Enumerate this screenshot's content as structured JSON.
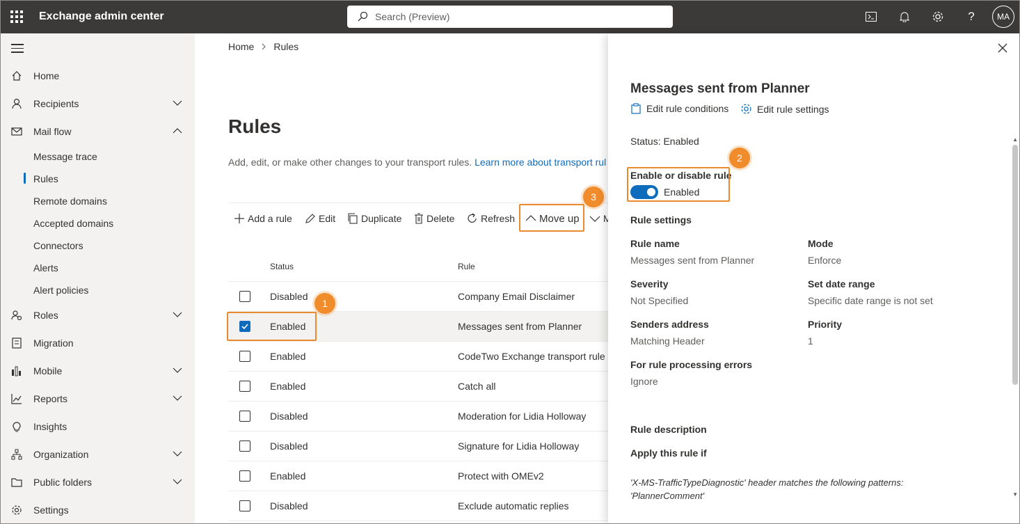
{
  "topbar": {
    "app_title": "Exchange admin center",
    "search_placeholder": "Search (Preview)",
    "avatar_initials": "MA"
  },
  "sidebar": {
    "items": [
      {
        "label": "Home",
        "icon": "home-icon"
      },
      {
        "label": "Recipients",
        "icon": "person-icon"
      },
      {
        "label": "Mail flow",
        "icon": "mail-icon"
      },
      {
        "label": "Roles",
        "icon": "roles-icon"
      },
      {
        "label": "Migration",
        "icon": "migration-icon"
      },
      {
        "label": "Mobile",
        "icon": "mobile-icon"
      },
      {
        "label": "Reports",
        "icon": "reports-icon"
      },
      {
        "label": "Insights",
        "icon": "lightbulb-icon"
      },
      {
        "label": "Organization",
        "icon": "organization-icon"
      },
      {
        "label": "Public folders",
        "icon": "folder-icon"
      },
      {
        "label": "Settings",
        "icon": "gear-icon"
      }
    ],
    "mail_flow_subitems": [
      "Message trace",
      "Rules",
      "Remote domains",
      "Accepted domains",
      "Connectors",
      "Alerts",
      "Alert policies"
    ]
  },
  "main": {
    "breadcrumb": {
      "home": "Home",
      "current": "Rules"
    },
    "title": "Rules",
    "description": "Add, edit, or make other changes to your transport rules.",
    "learn_more": "Learn more about transport rul",
    "commands": {
      "add": "Add a rule",
      "edit": "Edit",
      "duplicate": "Duplicate",
      "delete": "Delete",
      "refresh": "Refresh",
      "move_up": "Move up",
      "move_down": "M"
    },
    "columns": {
      "status": "Status",
      "rule": "Rule"
    },
    "rows": [
      {
        "status": "Disabled",
        "rule": "Company Email Disclaimer"
      },
      {
        "status": "Enabled",
        "rule": "Messages sent from Planner"
      },
      {
        "status": "Enabled",
        "rule": "CodeTwo Exchange transport rule"
      },
      {
        "status": "Enabled",
        "rule": "Catch all"
      },
      {
        "status": "Disabled",
        "rule": "Moderation for Lidia Holloway"
      },
      {
        "status": "Disabled",
        "rule": "Signature for Lidia Holloway"
      },
      {
        "status": "Enabled",
        "rule": "Protect with OMEv2"
      },
      {
        "status": "Disabled",
        "rule": "Exclude automatic replies"
      }
    ]
  },
  "callouts": {
    "one": "1",
    "two": "2",
    "three": "3"
  },
  "panel": {
    "title": "Messages sent from Planner",
    "edit_conditions": "Edit rule conditions",
    "edit_settings": "Edit rule settings",
    "status": "Status: Enabled",
    "enable_label": "Enable or disable rule",
    "toggle_text": "Enabled",
    "rule_settings_heading": "Rule settings",
    "fields": {
      "rule_name_label": "Rule name",
      "rule_name_value": "Messages sent from Planner",
      "mode_label": "Mode",
      "mode_value": "Enforce",
      "severity_label": "Severity",
      "severity_value": "Not Specified",
      "date_label": "Set date range",
      "date_value": "Specific date range is not set",
      "senders_label": "Senders address",
      "senders_value": "Matching Header",
      "priority_label": "Priority",
      "priority_value": "1",
      "errors_label": "For rule processing errors",
      "errors_value": "Ignore"
    },
    "description_heading": "Rule description",
    "apply_heading": "Apply this rule if",
    "condition_line1": "'X-MS-TrafficTypeDiagnostic' header matches the following patterns:",
    "condition_line2": "'PlannerComment'"
  },
  "colors": {
    "accent": "#0f6cbd",
    "callout": "#f08c2c",
    "topbar": "#3b3a39"
  }
}
